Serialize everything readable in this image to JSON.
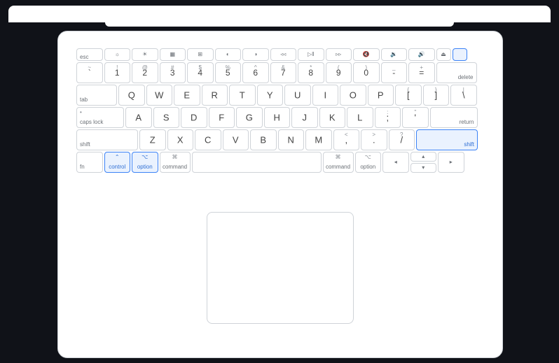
{
  "fn_row": {
    "esc": "esc",
    "keys": [
      {
        "sym": "☼"
      },
      {
        "sym": "☀"
      },
      {
        "sym": "▦"
      },
      {
        "sym": "⊞"
      },
      {
        "sym": "◐"
      },
      {
        "sym": "◑"
      },
      {
        "sym": "◃◃"
      },
      {
        "sym": "▷‖"
      },
      {
        "sym": "▹▹"
      },
      {
        "sym": "🔇"
      },
      {
        "sym": "🔉"
      },
      {
        "sym": "🔊"
      }
    ],
    "lock": {
      "sym": ""
    }
  },
  "num_row": {
    "keys": [
      {
        "top": "~",
        "bot": "`"
      },
      {
        "top": "!",
        "bot": "1"
      },
      {
        "top": "@",
        "bot": "2"
      },
      {
        "top": "#",
        "bot": "3"
      },
      {
        "top": "$",
        "bot": "4"
      },
      {
        "top": "%",
        "bot": "5"
      },
      {
        "top": "^",
        "bot": "6"
      },
      {
        "top": "&",
        "bot": "7"
      },
      {
        "top": "*",
        "bot": "8"
      },
      {
        "top": "(",
        "bot": "9"
      },
      {
        "top": ")",
        "bot": "0"
      },
      {
        "top": "_",
        "bot": "-"
      },
      {
        "top": "+",
        "bot": "="
      }
    ],
    "delete": "delete"
  },
  "q_row": {
    "tab": "tab",
    "letters": [
      "Q",
      "W",
      "E",
      "R",
      "T",
      "Y",
      "U",
      "I",
      "O",
      "P"
    ],
    "brackets": [
      {
        "top": "{",
        "bot": "["
      },
      {
        "top": "}",
        "bot": "]"
      },
      {
        "top": "|",
        "bot": "\\"
      }
    ]
  },
  "a_row": {
    "caps_top": "•",
    "caps": "caps lock",
    "letters": [
      "A",
      "S",
      "D",
      "F",
      "G",
      "H",
      "J",
      "K",
      "L"
    ],
    "semi": {
      "top": ":",
      "bot": ";"
    },
    "quote": {
      "top": "\"",
      "bot": "'"
    },
    "return": "return"
  },
  "z_row": {
    "shift_l": "shift",
    "letters": [
      "Z",
      "X",
      "C",
      "V",
      "B",
      "N",
      "M"
    ],
    "punct": [
      {
        "top": "<",
        "bot": ","
      },
      {
        "top": ">",
        "bot": "."
      },
      {
        "top": "?",
        "bot": "/"
      }
    ],
    "shift_r": "shift"
  },
  "mod_row": {
    "fn": "fn",
    "control": {
      "sym": "⌃",
      "label": "control"
    },
    "option_l": {
      "sym": "⌥",
      "label": "option"
    },
    "command_l": {
      "sym": "⌘",
      "label": "command"
    },
    "command_r": {
      "sym": "⌘",
      "label": "command"
    },
    "option_r": {
      "sym": "⌥",
      "label": "option"
    },
    "arrows": {
      "up": "▴",
      "down": "▾",
      "left": "◂",
      "right": "▸"
    }
  },
  "highlighted_keys": [
    "lock",
    "control",
    "option_l",
    "shift_r"
  ]
}
